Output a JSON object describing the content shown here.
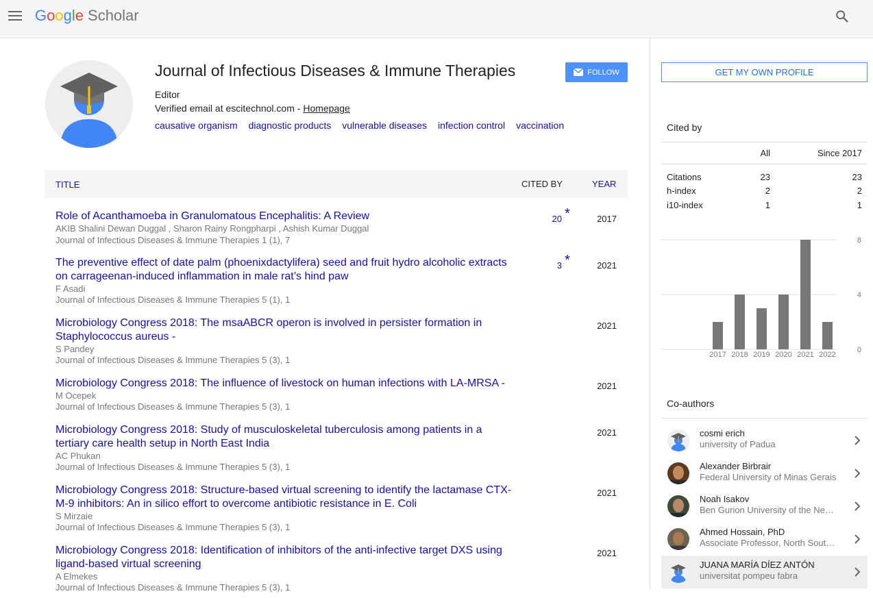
{
  "header": {
    "logo_google": [
      "G",
      "o",
      "o",
      "g",
      "l",
      "e"
    ],
    "logo_scholar": "Scholar"
  },
  "profile": {
    "name": "Journal of Infectious Diseases & Immune Therapies",
    "follow_label": "FOLLOW",
    "affiliation": "Editor",
    "email_text": "Verified email at escitechnol.com - ",
    "homepage_label": "Homepage",
    "interests": [
      "causative organism",
      "diagnostic products",
      "vulnerable diseases",
      "infection control",
      "vaccination"
    ]
  },
  "table": {
    "col_title": "TITLE",
    "col_cited": "CITED BY",
    "col_year": "YEAR",
    "rows": [
      {
        "title_l1": "Role of Acanthamoeba in Granulomatous Encephalitis: A Review",
        "title_l2": "",
        "authors": "AKIB Shalini Dewan Duggal , Sharon Rainy Rongpharpi , Ashish Kumar Duggal",
        "venue": "Journal of Infectious Diseases & Immune Therapies 1 (1), 7",
        "cited": "20",
        "star": "*",
        "year": "2017"
      },
      {
        "title_l1": "The preventive effect of date palm (phoenixdactylifera) seed and fruit hydro alcoholic extracts",
        "title_l2": "on carrageenan-induced inflammation in male rat’s hind paw",
        "authors": "F Asadi",
        "venue": "Journal of Infectious Diseases & Immune Therapies 5 (1), 1",
        "cited": "3",
        "star": "*",
        "year": "2021"
      },
      {
        "title_l1": "Microbiology Congress 2018: The msaABCR operon is involved in persister formation in",
        "title_l2": "Staphylococcus aureus -",
        "authors": "S Pandey",
        "venue": "Journal of Infectious Diseases & Immune Therapies 5 (3), 1",
        "cited": "",
        "star": "",
        "year": "2021"
      },
      {
        "title_l1": "Microbiology Congress 2018: The influence of livestock on human infections with LA-MRSA -",
        "title_l2": "",
        "authors": "M Ocepek",
        "venue": "Journal of Infectious Diseases & Immune Therapies 5 (3), 1",
        "cited": "",
        "star": "",
        "year": "2021"
      },
      {
        "title_l1": "Microbiology Congress 2018: Study of musculoskeletal tuberculosis among patients in a",
        "title_l2": "tertiary care health setup in North East India",
        "authors": "AC Phukan",
        "venue": "Journal of Infectious Diseases & Immune Therapies 5 (3), 1",
        "cited": "",
        "star": "",
        "year": "2021"
      },
      {
        "title_l1": "Microbiology Congress 2018: Structure-based virtual screening to identify the lactamase CTX-",
        "title_l2": "M-9 inhibitors: An in silico effort to overcome antibiotic resistance in E. Coli",
        "authors": "S Mirzaie",
        "venue": "Journal of Infectious Diseases & Immune Therapies 5 (3), 1",
        "cited": "",
        "star": "",
        "year": "2021"
      },
      {
        "title_l1": "Microbiology Congress 2018: Identification of inhibitors of the anti-infective target DXS using",
        "title_l2": "ligand-based virtual screening",
        "authors": "A Elmekes",
        "venue": "Journal of Infectious Diseases & Immune Therapies 5 (3), 1",
        "cited": "",
        "star": "",
        "year": "2021"
      }
    ]
  },
  "sidebar": {
    "own_profile_label": "GET MY OWN PROFILE",
    "cited_by_title": "Cited by",
    "col_all": "All",
    "col_since": "Since 2017",
    "metrics": [
      {
        "label": "Citations",
        "all": "23",
        "since": "23"
      },
      {
        "label": "h-index",
        "all": "2",
        "since": "2"
      },
      {
        "label": "i10-index",
        "all": "1",
        "since": "1"
      }
    ],
    "coauthors_title": "Co-authors",
    "coauthors": [
      {
        "name": "cosmi erich",
        "affil": "university of Padua",
        "avatar": "placeholder-avatar"
      },
      {
        "name": "Alexander Birbrair",
        "affil": "Federal University of Minas Gerais",
        "avatar": "photo-avatar"
      },
      {
        "name": "Noah Isakov",
        "affil": "Ben Gurion University of the Negev",
        "avatar": "photo-avatar"
      },
      {
        "name": "Ahmed Hossain, PhD",
        "affil": "Associate Professor, North South University",
        "avatar": "photo-avatar"
      },
      {
        "name": "JUANA MARÍA DÍEZ ANTÓN",
        "affil": "universitat pompeu fabra",
        "avatar": "placeholder-avatar"
      }
    ]
  },
  "chart_data": {
    "type": "bar",
    "categories": [
      "2017",
      "2018",
      "2019",
      "2020",
      "2021",
      "2022"
    ],
    "values": [
      2,
      4,
      3,
      4,
      8,
      2
    ],
    "yticks": [
      "0",
      "4",
      "8"
    ],
    "ylim": [
      0,
      8
    ],
    "bar_color": "#777777",
    "grid": true
  },
  "colors": {
    "link": "#1a0dab",
    "accent": "#4d90fe",
    "muted": "#777777"
  }
}
